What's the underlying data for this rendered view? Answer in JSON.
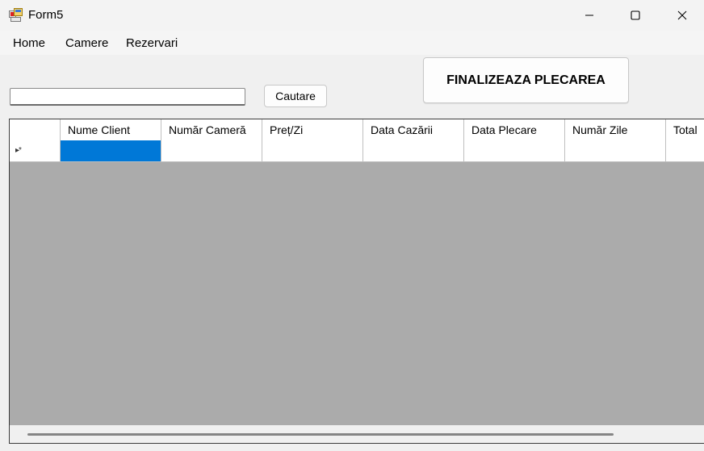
{
  "window": {
    "title": "Form5",
    "icon": "winforms-app-icon",
    "controls": [
      "minimize-icon",
      "maximize-icon",
      "close-icon"
    ]
  },
  "menu": {
    "items": [
      {
        "label": "Home"
      },
      {
        "label": "Camere"
      },
      {
        "label": "Rezervari"
      }
    ]
  },
  "search": {
    "value": "",
    "button_label": "Cautare"
  },
  "finalize": {
    "label": "FINALIZEAZA PLECAREA"
  },
  "grid": {
    "columns": [
      "Nume Client",
      "Număr Cameră",
      "Preț/Zi",
      "Data Cazării",
      "Data Plecare",
      "Număr Zile",
      "Total"
    ],
    "new_row_marker": "▸*",
    "rows": [
      [
        "",
        "",
        "",
        "",
        "",
        "",
        ""
      ]
    ],
    "selected_color": "#0078d7",
    "background_color": "#ababab"
  }
}
